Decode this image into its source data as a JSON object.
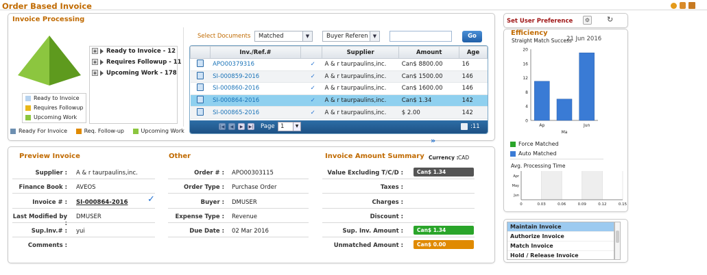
{
  "page_title": "Order Based Invoice",
  "processing": {
    "title": "Invoice Processing",
    "tree": [
      {
        "label": "Ready to Invoice - 12"
      },
      {
        "label": "Requires Followup - 11"
      },
      {
        "label": "Upcoming Work - 178"
      }
    ],
    "pyramid_legend": [
      {
        "label": "Ready to Invoice",
        "color": "#b7d3ef"
      },
      {
        "label": "Requires Followup",
        "color": "#e9b71a"
      },
      {
        "label": "Upcoming Work",
        "color": "#8cc63f"
      }
    ],
    "bottom_legend": [
      {
        "label": "Ready For Invoice",
        "color": "#6d8fb1"
      },
      {
        "label": "Req. Follow-up",
        "color": "#e08a00"
      },
      {
        "label": "Upcoming Work",
        "color": "#8cc63f"
      }
    ],
    "filter": {
      "label": "Select Documents",
      "status": "Matched",
      "type": "Buyer Referen",
      "search_value": "",
      "go": "Go"
    },
    "grid": {
      "columns": [
        "Inv./Ref.#",
        "Supplier",
        "Amount",
        "Age"
      ],
      "rows": [
        {
          "ref": "APO00379316",
          "supplier": "A & r taurpaulins,inc.",
          "amount": "Can$ 8800.00",
          "age": "16"
        },
        {
          "ref": "SI-000859-2016",
          "supplier": "A & r taurpaulins,inc.",
          "amount": "Can$ 1500.00",
          "age": "146"
        },
        {
          "ref": "SI-000860-2016",
          "supplier": "A & r taurpaulins,inc.",
          "amount": "Can$ 1600.00",
          "age": "146"
        },
        {
          "ref": "SI-000864-2016",
          "supplier": "A & r taurpaulins,inc.",
          "amount": "Can$ 1.34",
          "age": "142"
        },
        {
          "ref": "SI-000865-2016",
          "supplier": "A & r taurpaulins,inc.",
          "amount": "$ 2.00",
          "age": "142"
        }
      ],
      "page_label": "Page",
      "page_value": "1",
      "count": ":11"
    }
  },
  "preview": {
    "title": "Preview Invoice",
    "supplier_label": "Supplier :",
    "supplier": "A & r taurpaulins,inc.",
    "finance_label": "Finance Book :",
    "finance": "AVEOS",
    "invoice_label": "Invoice # :",
    "invoice": "SI-000864-2016",
    "modified_label": "Last Modified by :",
    "modified": "DMUSER",
    "supinv_label": "Sup.Inv.# :",
    "supinv": "yui",
    "comments_label": "Comments :"
  },
  "other": {
    "title": "Other",
    "order_label": "Order # :",
    "order": "APO00303115",
    "ordertype_label": "Order Type :",
    "ordertype": "Purchase Order",
    "buyer_label": "Buyer :",
    "buyer": "DMUSER",
    "expense_label": "Expense Type :",
    "expense": "Revenue",
    "due_label": "Due Date :",
    "due": "02 Mar 2016"
  },
  "summary": {
    "title": "Invoice Amount Summary",
    "currency_label": "Currency :",
    "currency": "CAD",
    "value_label": "Value Excluding T/C/D :",
    "value": "Can$ 1.34",
    "value_color": "#555555",
    "taxes_label": "Taxes :",
    "charges_label": "Charges :",
    "discount_label": "Discount :",
    "supinv_amt_label": "Sup. Inv. Amount :",
    "supinv_amt": "Can$ 1.34",
    "supinv_color": "#2aa52a",
    "unmatched_label": "Unmatched Amount :",
    "unmatched": "Can$ 0.00",
    "unmatched_color": "#e08a00"
  },
  "preference": {
    "label": "Set User Preference"
  },
  "efficiency": {
    "title": "Efficiency",
    "date": "21 Jun 2016",
    "legend": [
      {
        "label": "Force Matched",
        "color": "#2aa52a"
      },
      {
        "label": "Auto Matched",
        "color": "#3a7bd5"
      }
    ]
  },
  "chart_data": [
    {
      "type": "bar",
      "title": "Straight Match Success",
      "categories": [
        "Ap",
        "Ma",
        "Jun"
      ],
      "values": [
        11,
        6,
        19
      ],
      "ylim": [
        0,
        20
      ],
      "yticks": [
        "20",
        "16",
        "12",
        "8",
        "4",
        "0"
      ],
      "color": "#3a7bd5"
    },
    {
      "type": "bar",
      "title": "Avg. Processing Time",
      "categories": [
        "Apr",
        "May",
        "Jun"
      ],
      "values": [
        0,
        0,
        0
      ],
      "xlim": [
        0,
        0.15
      ],
      "xticks": [
        "0",
        "0.03",
        "0.06",
        "0.09",
        "0.12",
        "0.15"
      ]
    }
  ],
  "actions": [
    {
      "label": "Maintain Invoice",
      "selected": true
    },
    {
      "label": "Authorize Invoice"
    },
    {
      "label": "Match Invoice"
    },
    {
      "label": "Hold / Release Invoice"
    }
  ]
}
